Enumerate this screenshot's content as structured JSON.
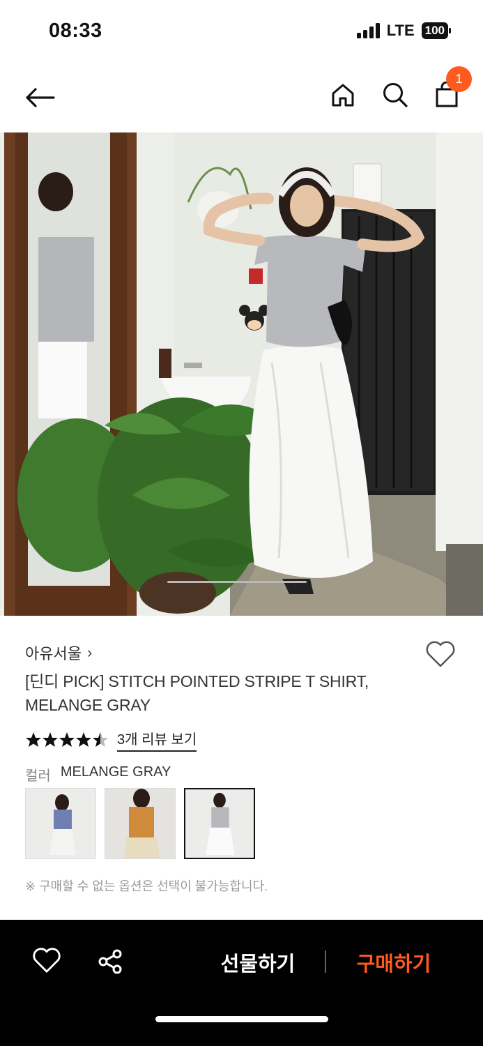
{
  "status_bar": {
    "time": "08:33",
    "network": "LTE",
    "battery": "100"
  },
  "nav": {
    "cart_count": "1"
  },
  "product": {
    "brand": "아유서울",
    "brand_chevron": "›",
    "title": "[딘디 PICK] STITCH POINTED STRIPE T SHIRT, MELANGE GRAY",
    "rating": 4.5,
    "review_link": "3개 리뷰 보기",
    "color_label": "컬러",
    "color_value": "MELANGE GRAY",
    "options": [
      {
        "name": "blue",
        "top_color": "#6f7fb3",
        "bottom_color": "#f2f2f2",
        "selected": false
      },
      {
        "name": "orange",
        "top_color": "#d08a3c",
        "bottom_color": "#e8dcc0",
        "selected": false
      },
      {
        "name": "melange-gray",
        "top_color": "#b7b8bb",
        "bottom_color": "#fafafa",
        "selected": true
      }
    ],
    "notice": "※ 구매할 수 없는 옵션은 선택이 불가능합니다."
  },
  "bottom_bar": {
    "gift_label": "선물하기",
    "buy_label": "구매하기"
  },
  "colors": {
    "accent": "#ff5a1f",
    "bar_bg": "#000000"
  }
}
